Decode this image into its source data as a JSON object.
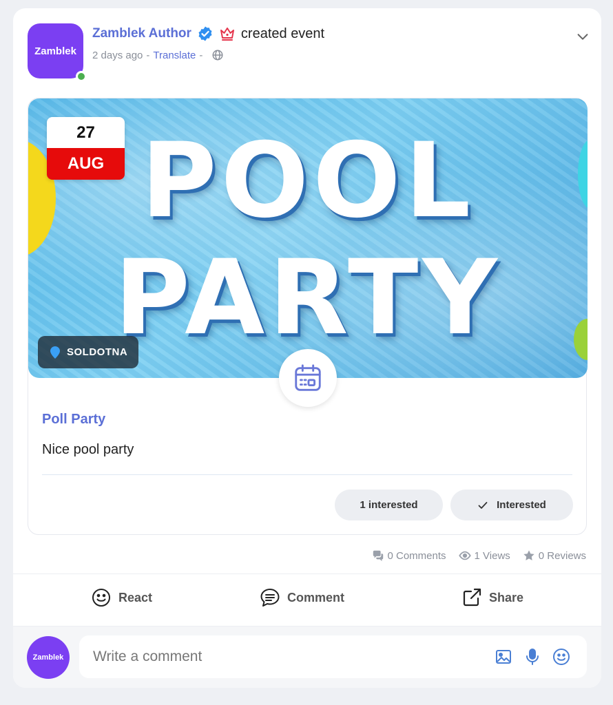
{
  "post": {
    "avatar_text": "Zamblek",
    "author": "Zamblek Author",
    "action": "created event",
    "time": "2 days ago",
    "dash1": "-",
    "translate": "Translate",
    "dash2": "-"
  },
  "event": {
    "banner_line1": "POOL",
    "banner_line2": "PARTY",
    "day": "27",
    "month": "AUG",
    "location": "SOLDOTNA",
    "title": "Poll Party",
    "description": "Nice pool party",
    "interested_count": "1 interested",
    "interested_label": "Interested"
  },
  "stats": {
    "comments": "0 Comments",
    "views": "1 Views",
    "reviews": "0 Reviews"
  },
  "actions": {
    "react": "React",
    "comment": "Comment",
    "share": "Share"
  },
  "comment_bar": {
    "avatar_text": "Zamblek",
    "placeholder": "Write a comment"
  },
  "colors": {
    "brand": "#7b3ff2",
    "link": "#5b6fd6",
    "online": "#4caf50",
    "date_red": "#e60b0b"
  },
  "icons": [
    "verified-icon",
    "crown-icon",
    "globe-icon",
    "chevron-down-icon",
    "pin-icon",
    "calendar-icon",
    "check-icon",
    "comments-icon",
    "eye-icon",
    "star-icon",
    "smiley-icon",
    "chat-bubble-icon",
    "share-icon",
    "image-icon",
    "mic-icon",
    "emoji-icon"
  ]
}
